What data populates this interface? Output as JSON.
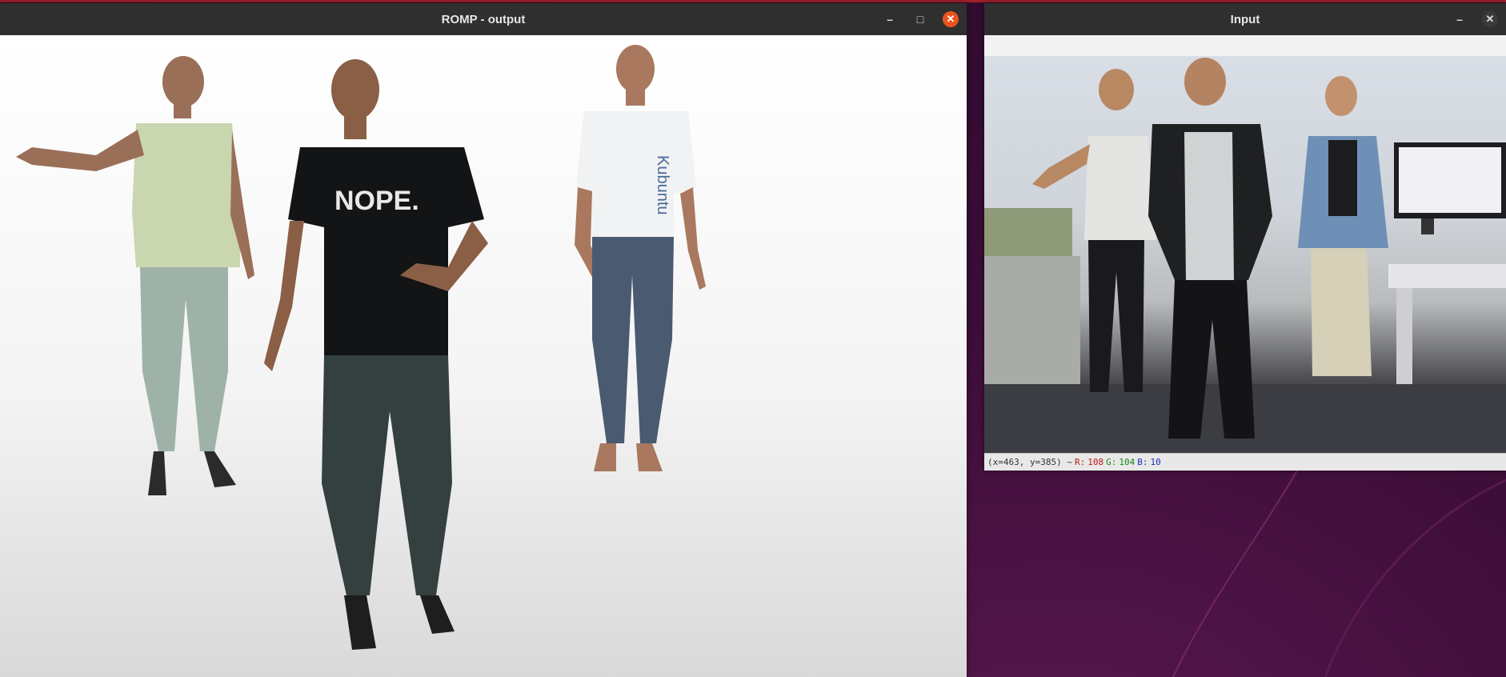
{
  "windows": {
    "output": {
      "title": "ROMP - output",
      "buttons": {
        "minimize": "–",
        "maximize": "□",
        "close": "✕"
      },
      "meshes": [
        {
          "shirt_color": "#c9d6b0",
          "pants_color": "#9fb2a8",
          "skin_color": "#9a6f58"
        },
        {
          "shirt_color": "#131416",
          "pants_color": "#33403f",
          "skin_color": "#8a5f46",
          "shirt_text": "NOPE."
        },
        {
          "shirt_color": "#f1f2f3",
          "pants_color": "#4a5a70",
          "skin_color": "#a9785e",
          "shirt_text": "Kubuntu"
        }
      ]
    },
    "input": {
      "title": "Input",
      "buttons": {
        "minimize": "–",
        "close": "✕"
      },
      "status": {
        "coords": "(x=463, y=385) ~",
        "r_label": "R:",
        "r_value": "108",
        "g_label": "G:",
        "g_value": "104",
        "b_label": "B:",
        "b_value": "10"
      }
    }
  },
  "colors": {
    "desktop_bg": "#3a0d36",
    "titlebar": "#2f2f2f",
    "close_button": "#e9541f"
  }
}
